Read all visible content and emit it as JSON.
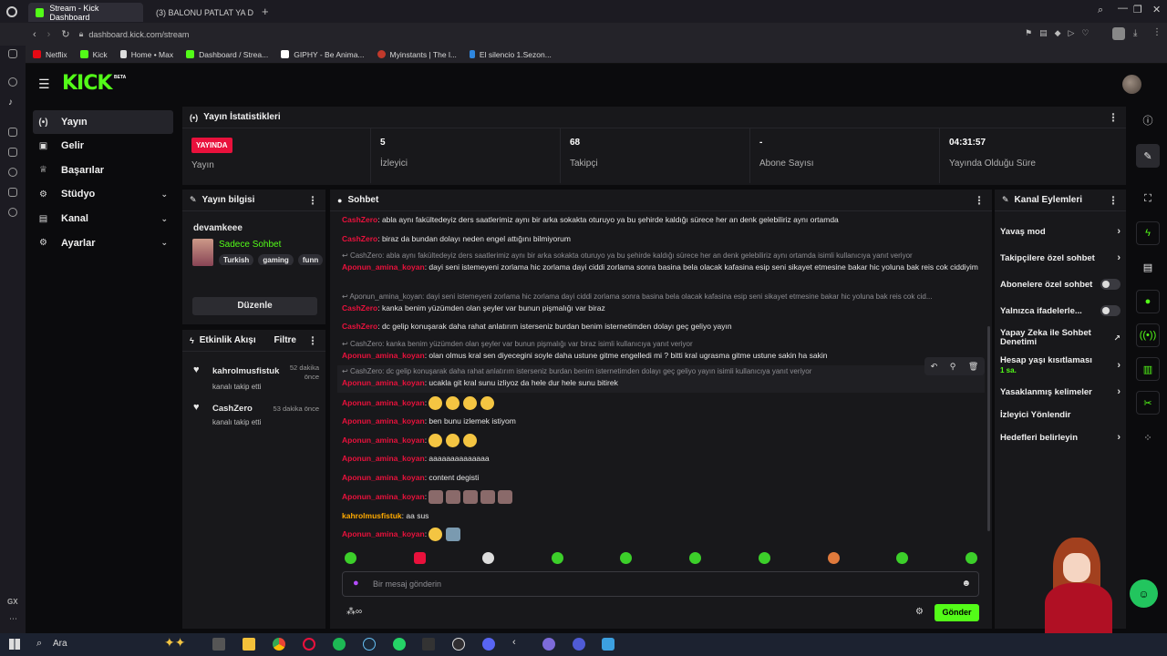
{
  "browser": {
    "tabs": [
      {
        "label": "Stream - Kick Dashboard",
        "active": true
      },
      {
        "label": "(3) BALONU PATLAT YA D",
        "active": false
      }
    ],
    "url": "dashboard.kick.com/stream",
    "bookmarks": [
      "Netflix",
      "Kick",
      "Home • Max",
      "Dashboard / Strea...",
      "GIPHY - Be Anima...",
      "Myinstants | The l...",
      "El silencio 1.Sezon..."
    ],
    "os_gx_label": "GX"
  },
  "kick": {
    "logo": "KICK",
    "logo_sup": "BETA"
  },
  "leftnav": {
    "items": [
      {
        "label": "Yayın",
        "icon": "broadcast-icon",
        "glyph": "(•)",
        "active": true,
        "chevron": false
      },
      {
        "label": "Gelir",
        "icon": "income-icon",
        "glyph": "▣",
        "active": false,
        "chevron": false
      },
      {
        "label": "Başarılar",
        "icon": "trophy-icon",
        "glyph": "♕",
        "active": false,
        "chevron": false
      },
      {
        "label": "Stüdyo",
        "icon": "studio-icon",
        "glyph": "⚙",
        "active": false,
        "chevron": true
      },
      {
        "label": "Kanal",
        "icon": "channel-icon",
        "glyph": "▤",
        "active": false,
        "chevron": true
      },
      {
        "label": "Ayarlar",
        "icon": "settings-icon",
        "glyph": "⚙",
        "active": false,
        "chevron": true
      }
    ]
  },
  "stats": {
    "title": "Yayın İstatistikleri",
    "live_badge": "YAYINDA",
    "live_label": "Yayın",
    "viewers_value": "5",
    "viewers_label": "İzleyici",
    "followers_value": "68",
    "followers_label": "Takipçi",
    "subs_value": "-",
    "subs_label": "Abone Sayısı",
    "uptime_value": "04:31:57",
    "uptime_label": "Yayında Olduğu Süre"
  },
  "info": {
    "title": "Yayın bilgisi",
    "channel": "devamkeee",
    "category": "Sadece Sohbet",
    "tags": [
      "Turkish",
      "gaming",
      "funn"
    ],
    "edit_button": "Düzenle"
  },
  "activity": {
    "title": "Etkinlik Akışı",
    "filter": "Filtre",
    "items": [
      {
        "user": "kahrolmusfistuk",
        "time": "52 dakika önce",
        "action": "kanalı takip etti"
      },
      {
        "user": "CashZero",
        "time": "53 dakika önce",
        "action": "kanalı takip etti"
      }
    ]
  },
  "chat": {
    "title": "Sohbet",
    "placeholder": "Bir mesaj gönderin",
    "send": "Gönder",
    "messages": [
      {
        "user": "CashZero",
        "text": "abla aynı fakültedeyiz ders saatlerimiz aynı bir arka sokakta oturuyo ya bu şehirde kaldığı sürece her an denk gelebiliriz aynı ortamda"
      },
      {
        "user": "CashZero",
        "text": "biraz da bundan dolayı neden engel attığını bilmiyorum"
      },
      {
        "reply": "CashZero: abla aynı fakültedeyiz ders saatlerimiz aynı bir arka sokakta oturuyo ya bu şehirde kaldığı sürece her an denk gelebiliriz aynı ortamda isimli kullanıcıya yanıt veriyor",
        "user": "Aponun_amina_koyan",
        "text": "dayi seni istemeyeni zorlama hic zorlama dayi ciddi zorlama sonra basina bela olacak kafasina esip seni sikayet etmesine bakar hic yoluna bak reis cok ciddiyim"
      },
      {
        "reply": "Aponun_amina_koyan: dayi seni istemeyeni zorlama hic zorlama dayi ciddi zorlama sonra basina bela olacak kafasina esip seni sikayet etmesine bakar hic yoluna bak reis cok cid...",
        "user": "CashZero",
        "text": "kanka benim yüzümden olan şeyler var bunun pişmalığı var biraz"
      },
      {
        "user": "CashZero",
        "text": "dc gelip konuşarak daha rahat anlatırım isterseniz burdan benim isternetimden dolayı geç geliyo yayın"
      },
      {
        "reply": "CashZero: kanka benim yüzümden olan şeyler var bunun pişmalığı var biraz isimli kullanıcıya yanıt veriyor",
        "user": "Aponun_amina_koyan",
        "text": "olan olmus kral sen diyecegini soyle daha ustune gitme engelledi mi ? bitti kral ugrasma gitme ustune sakin ha sakin"
      },
      {
        "reply": "CashZero: dc gelip konuşarak daha rahat anlatırım isterseniz burdan benim isternetimden dolayı geç geliyo yayın isimli kullanıcıya yanıt veriyor",
        "user": "Aponun_amina_koyan",
        "text": "ucakla git kral sunu izliyoz da hele dur hele sunu bitirek"
      },
      {
        "user": "Aponun_amina_koyan",
        "text": ""
      },
      {
        "user": "Aponun_amina_koyan",
        "text": "ben bunu izlemek istiyom"
      },
      {
        "user": "Aponun_amina_koyan",
        "text": ""
      },
      {
        "user": "Aponun_amina_koyan",
        "text": "aaaaaaaaaaaaaa"
      },
      {
        "user": "Aponun_amina_koyan",
        "text": "content degisti"
      },
      {
        "user": "Aponun_amina_koyan",
        "text": ""
      },
      {
        "user": "kahrolmusfistuk",
        "text": "aa sus"
      },
      {
        "user": "Aponun_amina_koyan",
        "text": ""
      }
    ]
  },
  "kanal": {
    "title": "Kanal Eylemleri",
    "actions": [
      {
        "label": "Yavaş mod",
        "kind": "arrow"
      },
      {
        "label": "Takipçilere özel sohbet",
        "kind": "arrow"
      },
      {
        "label": "Abonelere özel sohbet",
        "kind": "toggle"
      },
      {
        "label": "Yalnızca ifadelerle...",
        "kind": "toggle"
      },
      {
        "label": "Yapay Zeka ile Sohbet Denetimi",
        "kind": "external"
      },
      {
        "label": "Hesap yaşı kısıtlaması",
        "sub": "1 sa.",
        "kind": "arrow"
      },
      {
        "label": "Yasaklanmış kelimeler",
        "kind": "arrow"
      },
      {
        "label": "İzleyici Yönlendir",
        "kind": "none"
      },
      {
        "label": "Hedefleri belirleyin",
        "kind": "arrow"
      }
    ]
  },
  "taskbar": {
    "search": "Ara"
  },
  "colors": {
    "accent": "#53fc18",
    "live": "#e9113c",
    "user_a": "#e9113c",
    "user_k": "#ffaa00"
  }
}
